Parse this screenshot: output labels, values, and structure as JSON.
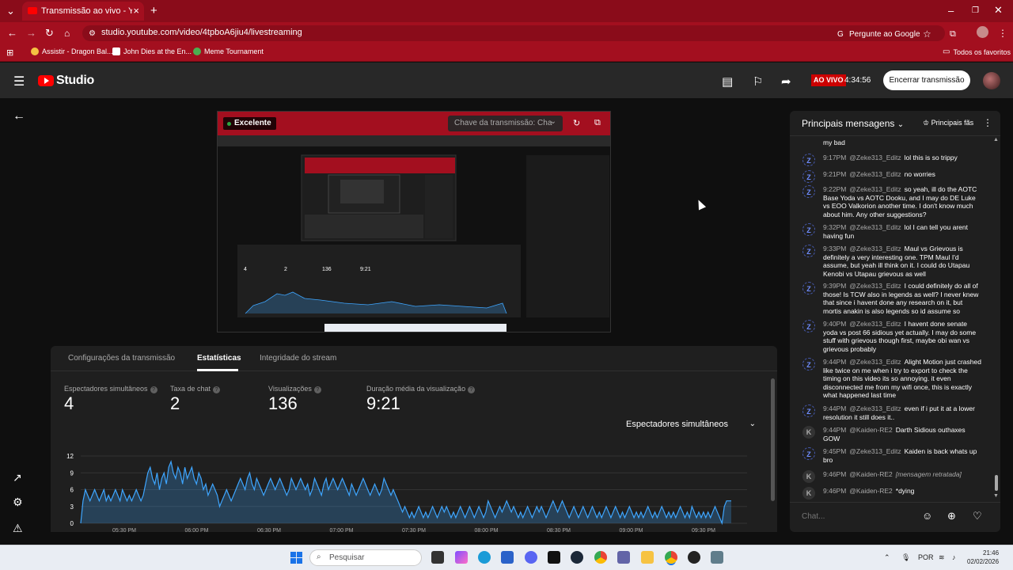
{
  "browser": {
    "tab_title": "Transmissão ao vivo - YouTube",
    "url": "studio.youtube.com/video/4tpboA6jiu4/livestreaming",
    "ask_google": "Pergunte ao Google",
    "bookmarks": [
      "Assistir - Dragon Bal...",
      "John Dies at the En...",
      "Meme Tournament"
    ],
    "all_bookmarks": "Todos os favoritos"
  },
  "header": {
    "logo_text": "Studio",
    "live_badge": "AO VIVO",
    "live_time": "4:34:56",
    "end_button": "Encerrar transmissão"
  },
  "preview": {
    "quality": "Excelente",
    "stream_key_placeholder": "Chave da transmissão: Cha"
  },
  "stats": {
    "tabs": [
      "Configurações da transmissão",
      "Estatísticas",
      "Integridade do stream"
    ],
    "active_tab": 1,
    "metrics": [
      {
        "label": "Espectadores simultâneos",
        "value": "4"
      },
      {
        "label": "Taxa de chat",
        "value": "2"
      },
      {
        "label": "Visualizações",
        "value": "136"
      },
      {
        "label": "Duração média da visualização",
        "value": "9:21"
      }
    ],
    "dropdown_value": "Espectadores simultâneos"
  },
  "chart_data": {
    "type": "area",
    "title": "",
    "xlabel": "",
    "ylabel": "",
    "ylim": [
      0,
      12
    ],
    "yticks": [
      0,
      3,
      6,
      9,
      12
    ],
    "x_tick_labels": [
      "05:30 PM",
      "06:00 PM",
      "06:30 PM",
      "07:00 PM",
      "07:30 PM",
      "08:00 PM",
      "08:30 PM",
      "09:00 PM",
      "09:30 PM"
    ],
    "grid": true,
    "series": [
      {
        "values": [
          0,
          4,
          6,
          5,
          4,
          5,
          6,
          5,
          4,
          5,
          6,
          4,
          5,
          4,
          5,
          6,
          5,
          4,
          6,
          5,
          4,
          5,
          4,
          5,
          6,
          5,
          4,
          5,
          7,
          9,
          10,
          8,
          7,
          9,
          6,
          8,
          9,
          7,
          10,
          11,
          9,
          8,
          10,
          9,
          7,
          10,
          8,
          9,
          10,
          8,
          7,
          9,
          8,
          6,
          7,
          5,
          6,
          7,
          6,
          5,
          3,
          4,
          5,
          6,
          5,
          4,
          5,
          6,
          7,
          8,
          7,
          6,
          8,
          9,
          7,
          6,
          8,
          7,
          6,
          5,
          6,
          7,
          8,
          7,
          6,
          7,
          8,
          7,
          6,
          5,
          6,
          8,
          7,
          6,
          7,
          8,
          7,
          6,
          7,
          5,
          6,
          8,
          7,
          6,
          5,
          7,
          8,
          6,
          7,
          8,
          7,
          6,
          7,
          8,
          7,
          6,
          5,
          7,
          6,
          5,
          6,
          7,
          8,
          7,
          6,
          5,
          6,
          7,
          6,
          5,
          6,
          8,
          7,
          6,
          5,
          6,
          5,
          4,
          3,
          2,
          3,
          2,
          1,
          2,
          1,
          2,
          3,
          2,
          1,
          2,
          1,
          2,
          3,
          2,
          1,
          2,
          3,
          2,
          3,
          2,
          1,
          2,
          1,
          2,
          3,
          2,
          1,
          2,
          3,
          2,
          1,
          2,
          3,
          2,
          1,
          2,
          4,
          3,
          2,
          1,
          2,
          3,
          2,
          3,
          4,
          3,
          2,
          3,
          2,
          1,
          2,
          1,
          2,
          3,
          2,
          1,
          2,
          3,
          2,
          3,
          2,
          1,
          2,
          3,
          4,
          3,
          2,
          3,
          4,
          3,
          2,
          1,
          2,
          3,
          2,
          1,
          2,
          3,
          2,
          1,
          2,
          3,
          2,
          1,
          2,
          1,
          2,
          3,
          2,
          1,
          2,
          3,
          2,
          1,
          2,
          1,
          2,
          3,
          2,
          1,
          2,
          1,
          2,
          1,
          2,
          3,
          2,
          1,
          2,
          1,
          2,
          3,
          2,
          1,
          2,
          1,
          2,
          1,
          2,
          3,
          2,
          1,
          2,
          1,
          3,
          2,
          1,
          2,
          1,
          2,
          1,
          2,
          1,
          2,
          3,
          2,
          1,
          0,
          3,
          4,
          4,
          4
        ]
      }
    ],
    "colors": {
      "line": "#3ea6ff",
      "fill": "rgba(62,166,255,0.25)"
    }
  },
  "chat": {
    "title": "Principais mensagens",
    "fans_button": "Principais fãs",
    "partial_top": "my bad",
    "messages": [
      {
        "avatar": "Z",
        "time": "9:17PM",
        "author": "@Zeke313_Editz",
        "text": "lol this is so trippy"
      },
      {
        "avatar": "Z",
        "time": "9:21PM",
        "author": "@Zeke313_Editz",
        "text": "no worries"
      },
      {
        "avatar": "Z",
        "time": "9:22PM",
        "author": "@Zeke313_Editz",
        "text": "so yeah, ill do the AOTC Base Yoda vs AOTC Dooku, and I may do DE Luke vs EOO Valkorion another time. I don't know much about him. Any other suggestions?"
      },
      {
        "avatar": "Z",
        "time": "9:32PM",
        "author": "@Zeke313_Editz",
        "text": "lol I can tell you arent having fun"
      },
      {
        "avatar": "Z",
        "time": "9:33PM",
        "author": "@Zeke313_Editz",
        "text": "Maul vs Grievous is definitely a very interesting one. TPM Maul I'd assume, but yeah ill think on it. I could do Utapau Kenobi vs Utapau grievous as well"
      },
      {
        "avatar": "Z",
        "time": "9:39PM",
        "author": "@Zeke313_Editz",
        "text": "I could definitely do all of those! Is TCW also in legends as well? I never knew that since i havent done any research on it, but mortis anakin is also legends so id assume so"
      },
      {
        "avatar": "Z",
        "time": "9:40PM",
        "author": "@Zeke313_Editz",
        "text": "I havent done senate yoda vs post 66 sidious yet actually. I may do some stuff with grievous though first, maybe obi wan vs grievous probably"
      },
      {
        "avatar": "Z",
        "time": "9:44PM",
        "author": "@Zeke313_Editz",
        "text": "Alight Motion just crashed like twice on me when i try to export to check the timing on this video its so annoying. it even disconnected me from my wifi once, this is exactly what happened last time"
      },
      {
        "avatar": "Z",
        "time": "9:44PM",
        "author": "@Zeke313_Editz",
        "text": "even if i put it at a lower resolution it still does it.."
      },
      {
        "avatar": "K",
        "time": "9:44PM",
        "author": "@Kaiden-RE2",
        "text": "Darth Sidious outhaxes GOW"
      },
      {
        "avatar": "Z",
        "time": "9:45PM",
        "author": "@Zeke313_Editz",
        "text": "Kaiden is back whats up bro"
      },
      {
        "avatar": "K",
        "time": "9:46PM",
        "author": "@Kaiden-RE2",
        "text": "[mensagem retratada]",
        "retracted": true
      },
      {
        "avatar": "K",
        "time": "9:46PM",
        "author": "@Kaiden-RE2",
        "text": "*dying"
      }
    ],
    "input_placeholder": "Chat..."
  },
  "taskbar": {
    "search": "Pesquisar",
    "language": "POR",
    "time": "21:46",
    "date": "02/02/2026"
  }
}
